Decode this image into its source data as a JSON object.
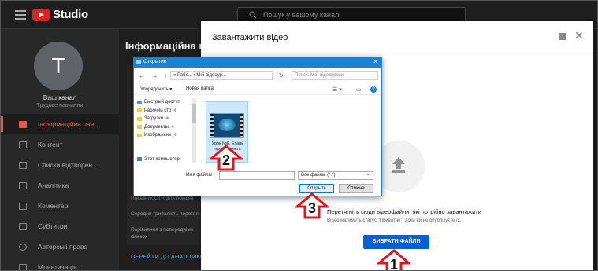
{
  "header": {
    "logo_text": "Studio",
    "search_placeholder": "Пошук у вашому каналі"
  },
  "sidebar": {
    "avatar_letter": "T",
    "channel_name": "Ваш канал",
    "channel_sub": "Трудове навчання",
    "items": [
      {
        "label": "Інформаційна пан...",
        "icon": "dashboard-icon",
        "active": true
      },
      {
        "label": "Контент",
        "icon": "video-icon"
      },
      {
        "label": "Списки відтворен...",
        "icon": "playlist-icon"
      },
      {
        "label": "Аналітика",
        "icon": "analytics-icon"
      },
      {
        "label": "Коментарі",
        "icon": "comments-icon"
      },
      {
        "label": "Субтитри",
        "icon": "subtitles-icon"
      },
      {
        "label": "Авторські права",
        "icon": "copyright-icon"
      },
      {
        "label": "Монетизація",
        "icon": "money-icon"
      }
    ]
  },
  "main": {
    "title": "Інформаційна па",
    "stats": [
      "Показник CTR для показів",
      "Середня тривалість перегля",
      "Порівняння з попередніми",
      "кількох"
    ],
    "analytics_link": "ПЕРЕЙТИ ДО АНАЛІТИКИ"
  },
  "upload_modal": {
    "title": "Завантажити відео",
    "drop_text": "Перетягніть сюди відеофайли, які потрібно завантажити",
    "drop_subtext": "Відео матимуть статус \"Приватне\", доки ви не опублікуєте їх.",
    "select_button": "ВИБРАТИ ФАЙЛИ"
  },
  "file_dialog": {
    "title": "Открытие",
    "nav_arrows": "← → ↑",
    "address": "« Рабо... › Мої відеоур...",
    "search_placeholder": "Поиск: Мої відеоуроки",
    "organize": "Упорядочить ▾",
    "new_folder": "Новая папка",
    "tree": [
      {
        "label": "Быстрый доступ",
        "kind": "star"
      },
      {
        "label": "Рабочий сто",
        "kind": "folder"
      },
      {
        "label": "Загрузки",
        "kind": "folder"
      },
      {
        "label": "Документы",
        "kind": "folder"
      },
      {
        "label": "Изображени",
        "kind": "folder"
      },
      {
        "label": "Этот компьютер",
        "kind": "pc"
      }
    ],
    "file_name": "Урок №8. Етапи проект...ня.m",
    "file_name_label": "Имя файла:",
    "file_type": "Все файлы (*.*)",
    "open_button": "Открыть",
    "cancel_button": "Отмена"
  },
  "annotations": [
    "1",
    "2",
    "3"
  ],
  "colors": {
    "accent_red": "#ff4e45",
    "upload_blue": "#065fd4",
    "dialog_blue": "#1883d7",
    "annotation_red": "#e8141b"
  }
}
